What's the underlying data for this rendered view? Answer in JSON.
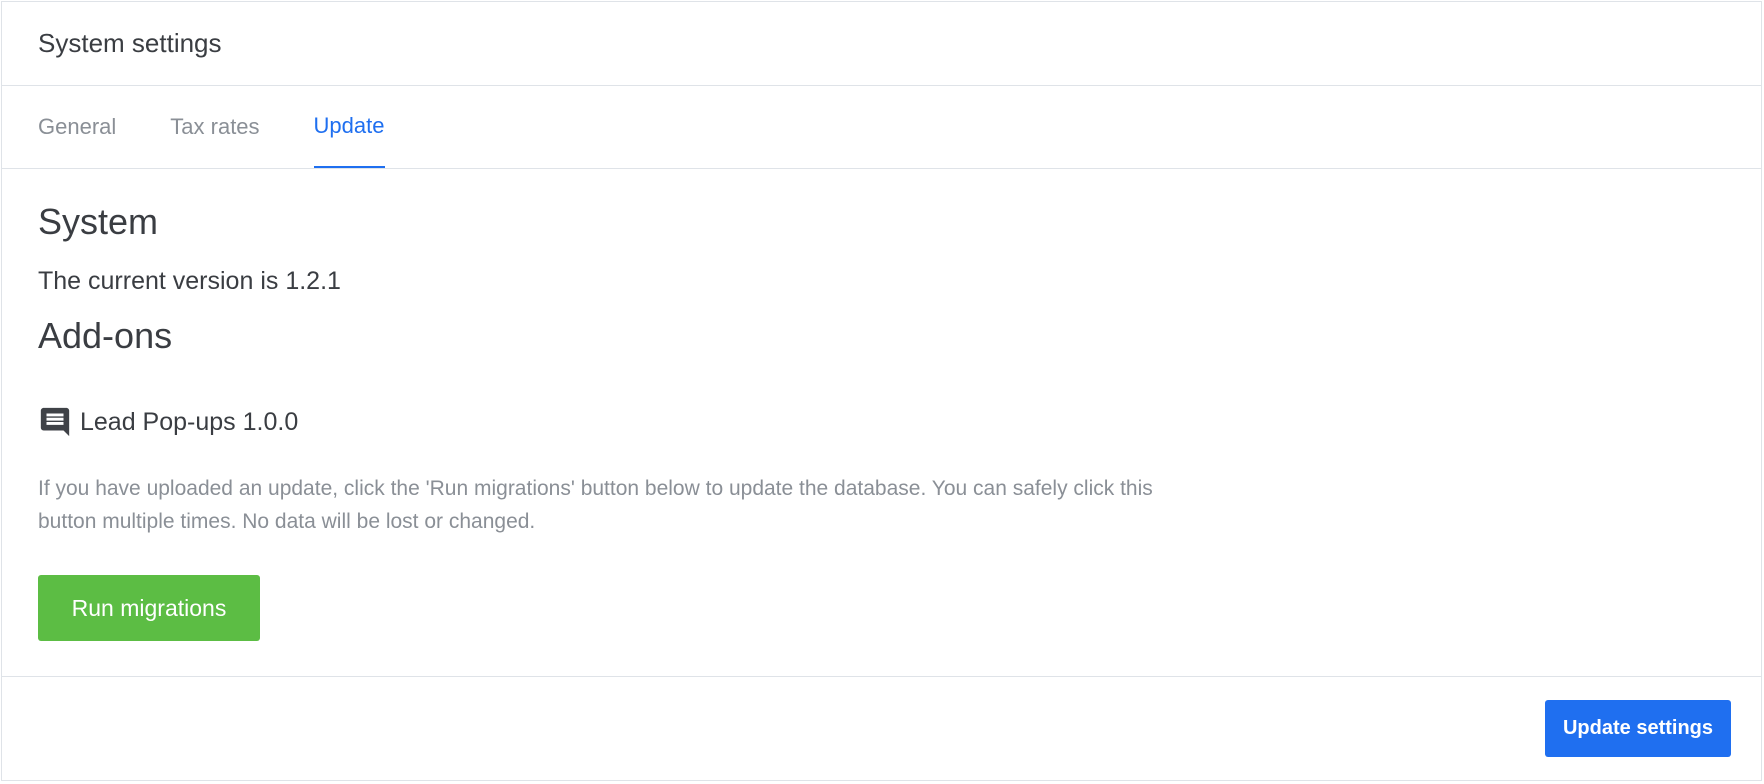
{
  "header": {
    "title": "System settings"
  },
  "tabs": [
    {
      "label": "General",
      "active": false
    },
    {
      "label": "Tax rates",
      "active": false
    },
    {
      "label": "Update",
      "active": true
    }
  ],
  "system": {
    "heading": "System",
    "version_text": "The current version is 1.2.1"
  },
  "addons": {
    "heading": "Add-ons",
    "items": [
      {
        "icon": "comment-icon",
        "label": "Lead Pop-ups 1.0.0"
      }
    ]
  },
  "help_text": "If you have uploaded an update, click the 'Run migrations' button below to update the database. You can safely click this button multiple times. No data will be lost or changed.",
  "buttons": {
    "run_migrations": "Run migrations",
    "update_settings": "Update settings"
  },
  "colors": {
    "accent_blue": "#1f6ff0",
    "success_green": "#5cbd44",
    "muted_text": "#8a8f96",
    "border": "#dfe3e8"
  }
}
